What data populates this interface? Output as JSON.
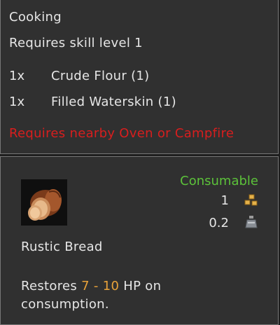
{
  "recipe": {
    "title": "Cooking",
    "skill_requirement": "Requires skill level 1",
    "ingredients": [
      {
        "qty": "1x",
        "name": "Crude Flour (1)"
      },
      {
        "qty": "1x",
        "name": "Filled Waterskin (1)"
      }
    ],
    "station_requirement": "Requires nearby Oven or Campfire"
  },
  "item": {
    "type": "Consumable",
    "value": "1",
    "weight": "0.2",
    "name": "Rustic Bread",
    "desc_prefix": "Restores ",
    "hp_range": "7 - 10",
    "desc_suffix": " HP on",
    "desc_line2": "consumption.",
    "icons": {
      "item": "bread-icon",
      "value": "coins-icon",
      "weight": "weight-icon"
    }
  },
  "colors": {
    "requirement": "#d81e1e",
    "type": "#5cc23a",
    "highlight": "#e8a23a"
  }
}
